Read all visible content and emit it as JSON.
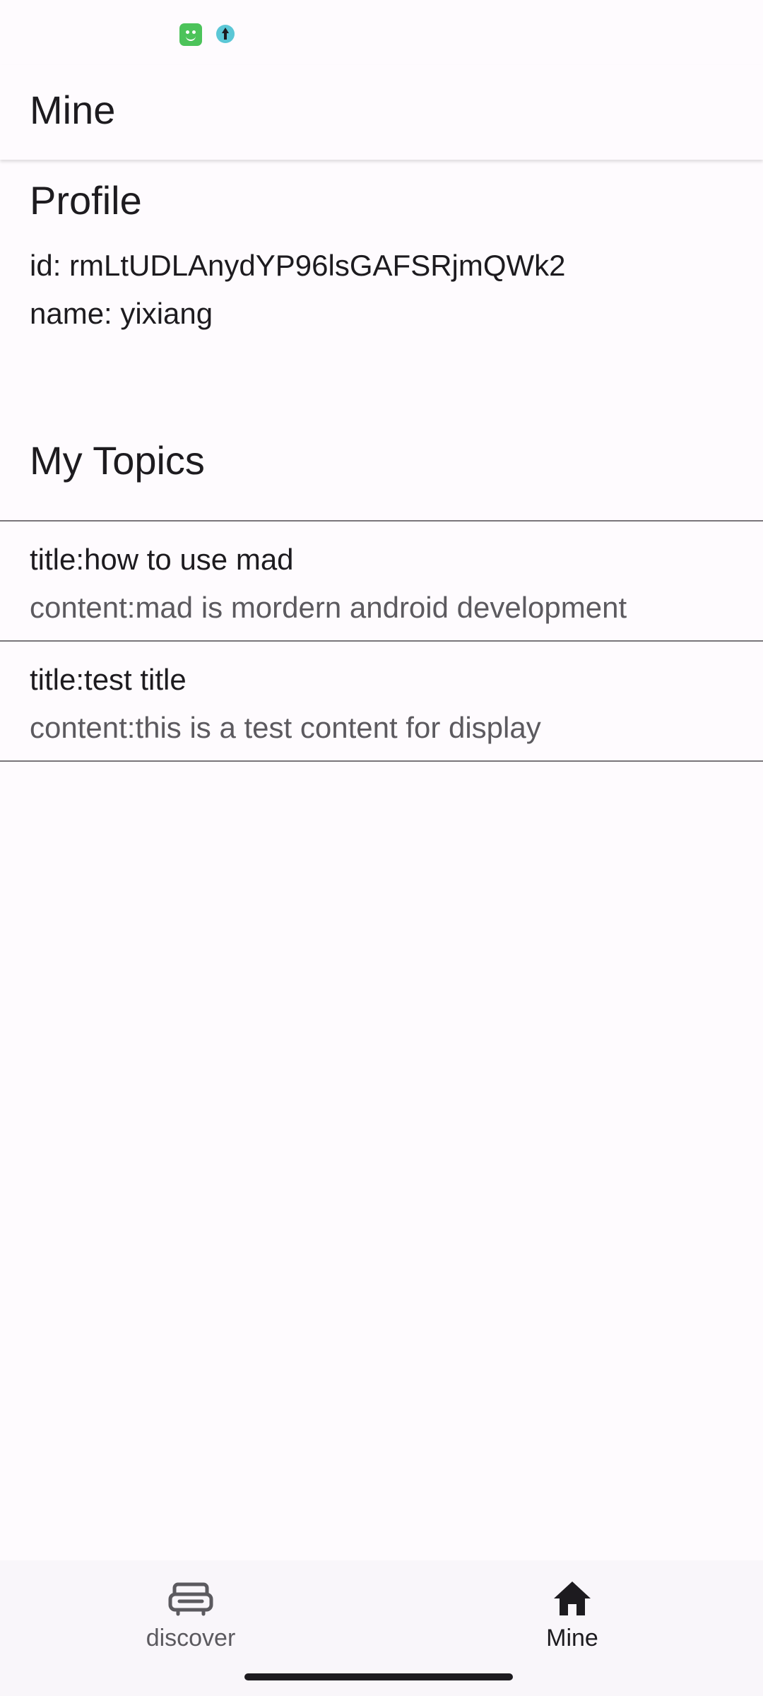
{
  "app_bar": {
    "title": "Mine"
  },
  "profile": {
    "heading": "Profile",
    "id_line": "id: rmLtUDLAnydYP96lsGAFSRjmQWk2",
    "name_line": "name: yixiang"
  },
  "topics": {
    "heading": "My Topics",
    "items": [
      {
        "title": "title:how to use mad",
        "content": "content:mad is mordern android development"
      },
      {
        "title": "title:test title",
        "content": "content:this is a test content for display"
      }
    ]
  },
  "bottom_nav": {
    "items": [
      {
        "label": "discover",
        "icon": "sofa-icon",
        "selected": false
      },
      {
        "label": "Mine",
        "icon": "home-icon",
        "selected": true
      }
    ]
  },
  "colors": {
    "background": "#fefbfe",
    "text_primary": "#1d1b1f",
    "text_secondary": "#5c5a5f",
    "divider": "#79757a",
    "nav_background": "#f9f6fa"
  }
}
